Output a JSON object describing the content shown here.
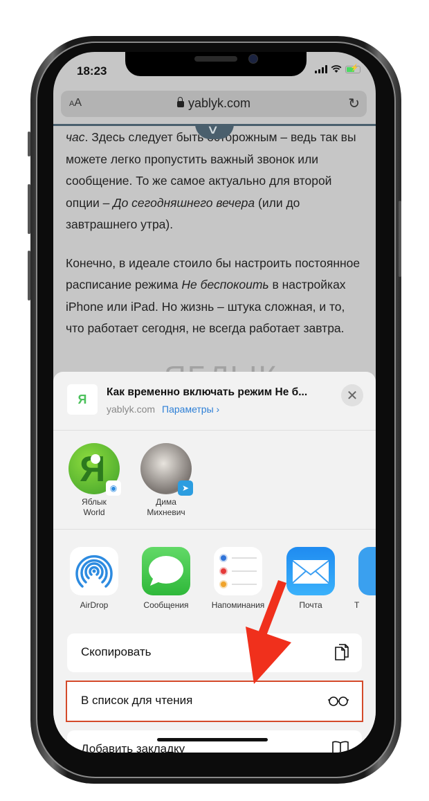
{
  "status_bar": {
    "time": "18:23"
  },
  "url_bar": {
    "text_size_label": "AA",
    "domain": "yablyk.com",
    "lock_icon": "lock-icon",
    "reload_icon": "reload-icon"
  },
  "article": {
    "paragraph1": {
      "italic_lead": "час",
      "text1": ". Здесь следует быть осторожным – ведь так вы можете легко пропустить важный звонок или сообщение. То же самое актуально для второй опции – ",
      "italic": "До сегодняшнего вечера",
      "text2": " (или до завтрашнего утра)."
    },
    "paragraph2": {
      "text1": "Конечно, в идеале стоило бы настроить постоянное расписание режима ",
      "italic": "Не беспокоить",
      "text2": " в настройках iPhone или iPad. Но жизнь – штука сложная, и то, что работает сегодня, не всегда работает завтра."
    },
    "watermark": "ЯБЛЫК"
  },
  "share_sheet": {
    "site_icon_letter": "Я",
    "title": "Как временно включать режим Не б...",
    "domain": "yablyk.com",
    "options_label": "Параметры ›",
    "close_icon": "✕",
    "people": [
      {
        "name_line1": "Яблык",
        "name_line2": "World",
        "badge": "airdrop"
      },
      {
        "name_line1": "Дима",
        "name_line2": "Михневич",
        "badge": "telegram"
      }
    ],
    "apps": [
      {
        "label": "AirDrop"
      },
      {
        "label": "Сообщения"
      },
      {
        "label": "Напоминания"
      },
      {
        "label": "Почта"
      },
      {
        "label": "Т"
      }
    ],
    "actions": [
      {
        "label": "Скопировать",
        "icon": "copy-icon"
      },
      {
        "label": "В список для чтения",
        "icon": "glasses-icon",
        "highlighted": true
      },
      {
        "label": "Добавить закладку",
        "icon": "book-icon"
      }
    ]
  },
  "annotation": {
    "arrow_color": "#f0301c",
    "highlight_color": "#d44a2a"
  }
}
